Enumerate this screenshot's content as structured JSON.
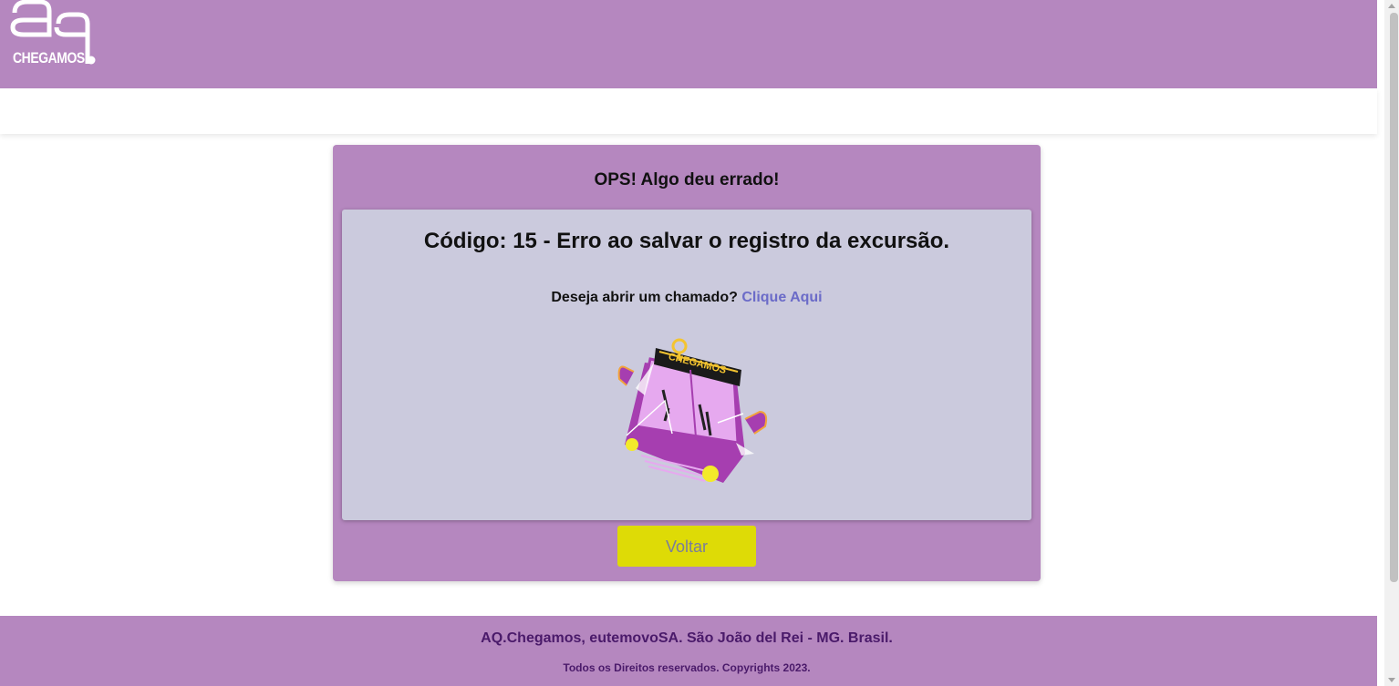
{
  "header": {
    "logo_text": "CHEGAMOS"
  },
  "error": {
    "title": "OPS! Algo deu errado!",
    "code_message": "Código: 15 - Erro ao salvar o registro da excursão.",
    "ticket_prompt": "Deseja abrir um chamado?",
    "ticket_link": "Clique Aqui",
    "illustration_icon": "broken-bus-icon",
    "illustration_sign_text": "CHEGAMOS",
    "back_button": "Voltar"
  },
  "footer": {
    "main": "AQ.Chegamos, eutemovoSA. São João del Rei - MG. Brasil.",
    "copyright": "Todos os Direitos reservados. Copyrights 2023."
  },
  "colors": {
    "primary_purple": "#b587bf",
    "inner_panel": "#cbcadd",
    "button_yellow": "#dedb06",
    "link": "#6b6bc8",
    "footer_text": "#4a1a6a"
  }
}
